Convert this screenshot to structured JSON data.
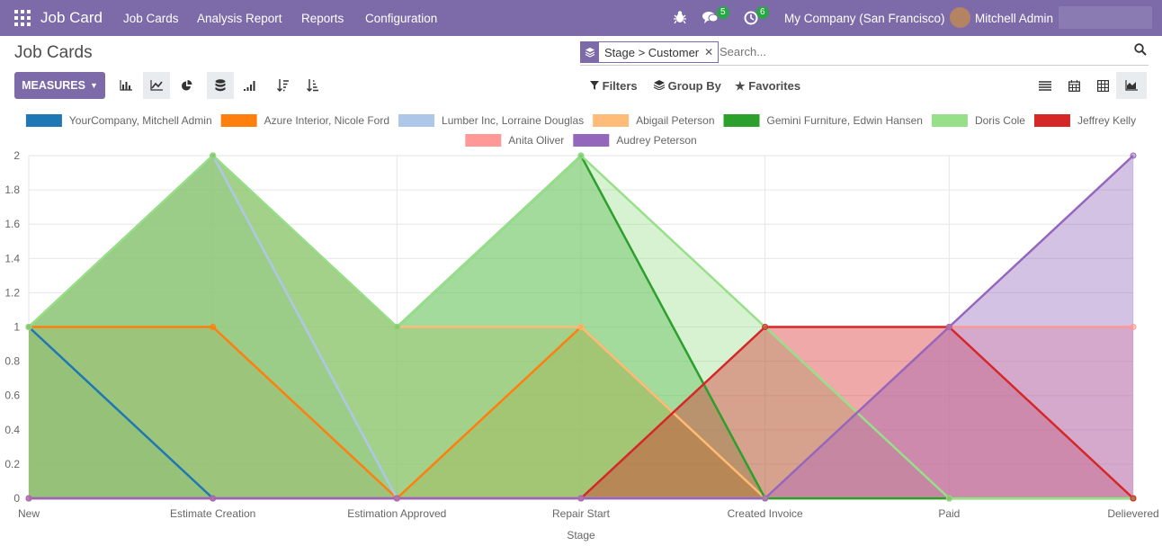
{
  "topbar": {
    "brand": "Job Card",
    "menu": [
      "Job Cards",
      "Analysis Report",
      "Reports",
      "Configuration"
    ],
    "messages_count": "5",
    "activities_count": "6",
    "company": "My Company (San Francisco)",
    "user": "Mitchell Admin"
  },
  "page": {
    "title": "Job Cards",
    "facet_label": "Stage > Customer",
    "search_placeholder": "Search...",
    "measures_label": "MEASURES",
    "filters_label": "Filters",
    "groupby_label": "Group By",
    "favorites_label": "Favorites"
  },
  "icons": {
    "apps": "apps-grid-icon",
    "bug": "bug-icon",
    "messages": "chat-icon",
    "activities": "clock-icon",
    "search": "search-icon",
    "bar": "bar-chart-icon",
    "line": "line-chart-icon",
    "pie": "pie-chart-icon",
    "stacked": "stacked-icon",
    "cumulative": "cumulative-icon",
    "desc": "sort-desc-icon",
    "asc": "sort-asc-icon"
  },
  "chart_data": {
    "type": "area",
    "title": "",
    "xlabel": "Stage",
    "ylabel": "",
    "ylim": [
      0,
      2
    ],
    "yticks": [
      "0",
      "0.2",
      "0.4",
      "0.6",
      "0.8",
      "1",
      "1.2",
      "1.4",
      "1.6",
      "1.8",
      "2"
    ],
    "grid": true,
    "legend_position": "top",
    "categories": [
      "New",
      "Estimate Creation",
      "Estimation Approved",
      "Repair Start",
      "Created Invoice",
      "Paid",
      "Delievered"
    ],
    "series": [
      {
        "name": "YourCompany, Mitchell Admin",
        "color": "#1f77b4",
        "values": [
          1,
          0,
          0,
          0,
          0,
          0,
          0
        ]
      },
      {
        "name": "Azure Interior, Nicole Ford",
        "color": "#ff7f0e",
        "values": [
          1,
          1,
          0,
          1,
          0,
          0,
          0
        ]
      },
      {
        "name": "Lumber Inc, Lorraine Douglas",
        "color": "#aec7e8",
        "values": [
          1,
          2,
          0,
          0,
          0,
          0,
          0
        ]
      },
      {
        "name": "Abigail Peterson",
        "color": "#ffbb78",
        "values": [
          1,
          2,
          1,
          1,
          0,
          0,
          0
        ]
      },
      {
        "name": "Gemini Furniture, Edwin Hansen",
        "color": "#2ca02c",
        "values": [
          1,
          2,
          1,
          2,
          0,
          0,
          0
        ]
      },
      {
        "name": "Doris Cole",
        "color": "#98df8a",
        "values": [
          1,
          2,
          1,
          2,
          1,
          0,
          0
        ]
      },
      {
        "name": "Jeffrey Kelly",
        "color": "#d62728",
        "values": [
          0,
          0,
          0,
          0,
          1,
          1,
          0
        ]
      },
      {
        "name": "Anita Oliver",
        "color": "#ff9896",
        "values": [
          0,
          0,
          0,
          0,
          0,
          1,
          1
        ]
      },
      {
        "name": "Audrey Peterson",
        "color": "#9467bd",
        "values": [
          0,
          0,
          0,
          0,
          0,
          1,
          2
        ]
      }
    ]
  }
}
